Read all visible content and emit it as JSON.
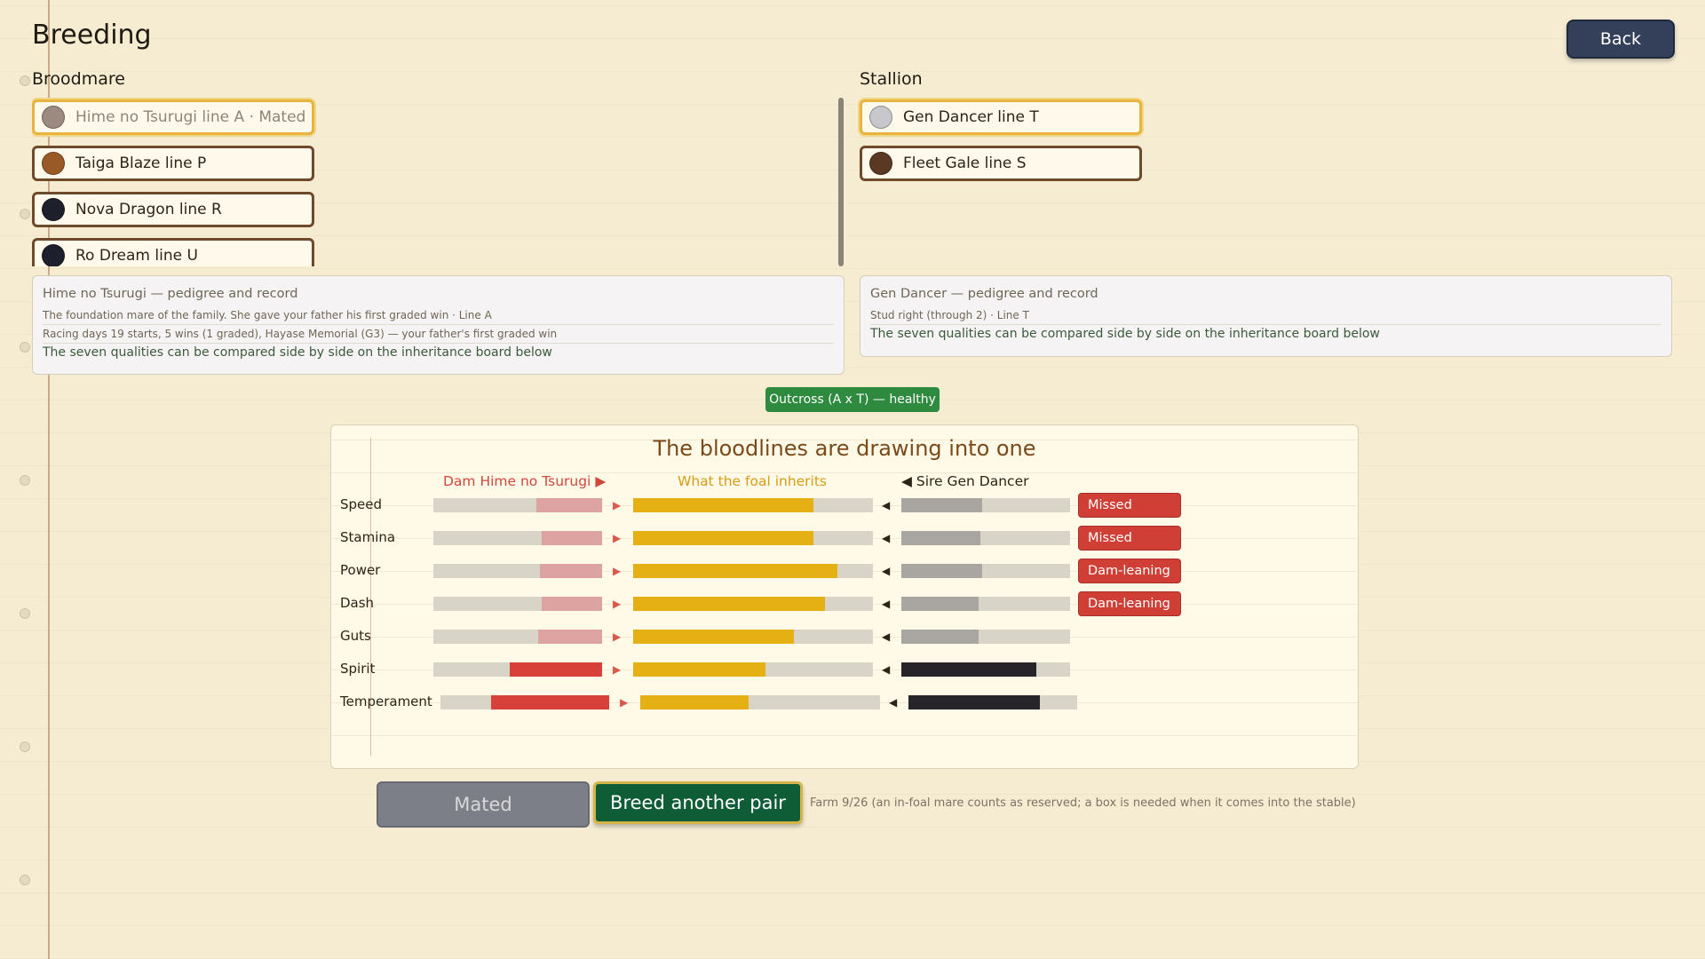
{
  "header": {
    "title": "Breeding",
    "back_label": "Back"
  },
  "broodmare": {
    "label": "Broodmare",
    "items": [
      {
        "name": "Hime no Tsurugi  line A · Mated",
        "color": "#9c8a80",
        "selected": true,
        "dim": true
      },
      {
        "name": "Taiga Blaze  line P",
        "color": "#9a5a28",
        "selected": false,
        "dim": false
      },
      {
        "name": "Nova Dragon  line R",
        "color": "#1d1f2c",
        "selected": false,
        "dim": false
      },
      {
        "name": "Ro Dream  line U",
        "color": "#1d1f2c",
        "selected": false,
        "dim": false
      }
    ],
    "info": {
      "heading": "Hime no Tsurugi  —  pedigree and record",
      "line1": "The foundation mare of the family. She gave your father his first graded win · Line A",
      "line2": "Racing days 19 starts, 5 wins (1 graded), Hayase Memorial (G3) — your father's first graded win",
      "line3": "The seven qualities can be compared side by side on the inheritance board below"
    }
  },
  "stallion": {
    "label": "Stallion",
    "items": [
      {
        "name": "Gen Dancer  line T",
        "color": "#c8c8cc",
        "selected": true,
        "dim": false
      },
      {
        "name": "Fleet Gale  line S",
        "color": "#5a3822",
        "selected": false,
        "dim": false
      }
    ],
    "info": {
      "heading": "Gen Dancer  —  pedigree and record",
      "line1": "Stud right (through 2) · Line T",
      "line2": "The seven qualities can be compared side by side on the inheritance board below"
    }
  },
  "cross_badge": "Outcross (A x T) — healthy",
  "board": {
    "title": "The bloodlines are drawing into one",
    "dam_header": "Dam Hime no Tsurugi",
    "foal_header": "What the foal inherits",
    "sire_header": "Sire Gen Dancer",
    "rows": [
      {
        "label": "Speed",
        "dam": 0.39,
        "foal": 0.75,
        "sire": 0.48,
        "strong": false,
        "tag": "Missed"
      },
      {
        "label": "Stamina",
        "dam": 0.36,
        "foal": 0.75,
        "sire": 0.47,
        "strong": false,
        "tag": "Missed"
      },
      {
        "label": "Power",
        "dam": 0.37,
        "foal": 0.85,
        "sire": 0.48,
        "strong": false,
        "tag": "Dam-leaning"
      },
      {
        "label": "Dash",
        "dam": 0.36,
        "foal": 0.8,
        "sire": 0.46,
        "strong": false,
        "tag": "Dam-leaning"
      },
      {
        "label": "Guts",
        "dam": 0.38,
        "foal": 0.67,
        "sire": 0.46,
        "strong": false,
        "tag": ""
      },
      {
        "label": "Spirit",
        "dam": 0.55,
        "foal": 0.55,
        "sire": 0.8,
        "strong": true,
        "tag": ""
      },
      {
        "label": "Temperament",
        "dam": 0.7,
        "foal": 0.45,
        "sire": 0.78,
        "strong": true,
        "tag": ""
      }
    ]
  },
  "buttons": {
    "mated_label": "Mated",
    "breed_label": "Breed another pair"
  },
  "farm_note": "Farm 9/26 (an in-foal mare counts as reserved; a box is needed when it comes into the stable)"
}
